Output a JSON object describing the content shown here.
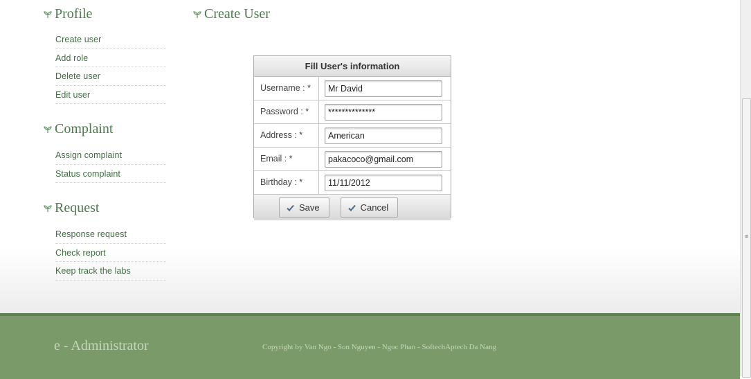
{
  "sidebar": {
    "sections": [
      {
        "title": "Profile",
        "items": [
          "Create user",
          "Add role",
          "Delete user",
          "Edit user"
        ]
      },
      {
        "title": "Complaint",
        "items": [
          "Assign complaint",
          "Status complaint"
        ]
      },
      {
        "title": "Request",
        "items": [
          "Response request",
          "Check report",
          "Keep track the labs"
        ]
      }
    ]
  },
  "main": {
    "title": "Create User",
    "form": {
      "header": "Fill User's information",
      "fields": [
        {
          "label": "Username : *",
          "value": "Mr David"
        },
        {
          "label": "Password : *",
          "value": "**************"
        },
        {
          "label": "Address : *",
          "value": "American"
        },
        {
          "label": "Email : *",
          "value": "pakacoco@gmail.com"
        },
        {
          "label": "Birthday : *",
          "value": "11/11/2012"
        }
      ],
      "save_label": "Save",
      "cancel_label": "Cancel"
    }
  },
  "footer": {
    "brand": "e - Administrator",
    "copyright": "Copyright by Van Ngo - Son Nguyen - Ngoc Phan - SoftechAptech Da Nang"
  },
  "colors": {
    "accent_green": "#4f7a4f",
    "footer_bg": "#7a9a6a"
  },
  "icons": {
    "section_icon": "leaf-icon",
    "button_icon": "checkmark-icon"
  }
}
